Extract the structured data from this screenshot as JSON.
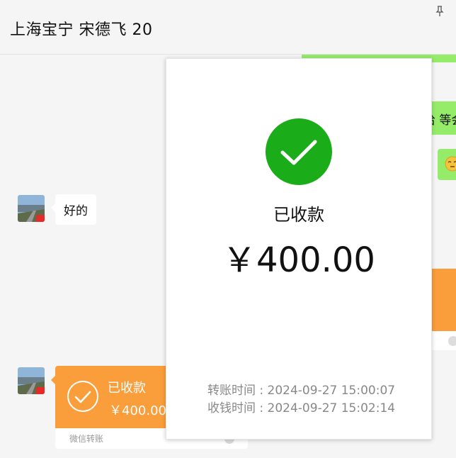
{
  "header": {
    "title": "上海宝宁 宋德飞 20",
    "pin_icon": "pin-icon"
  },
  "messages": [
    {
      "type": "text",
      "side": "left",
      "avatar": "avatar",
      "text": "好的"
    },
    {
      "type": "transfer",
      "side": "left",
      "status": "已收款",
      "amount": "￥400.00",
      "brand": "微信转账",
      "icon": "check-circle-icon"
    }
  ],
  "background_right": {
    "partial_text": "给 等会",
    "emoji_icon": "sleepy-face-emoji-icon"
  },
  "popup": {
    "icon": "check-circle-icon",
    "status": "已收款",
    "amount": "￥400.00",
    "transfer_time": "转账时间 : 2024-09-27 15:00:07",
    "receive_time": "收钱时间 : 2024-09-27 15:02:14"
  },
  "colors": {
    "wechat_green": "#1aad19",
    "bubble_green": "#95ec69",
    "transfer_orange": "#fa9d3b",
    "background": "#f5f5f5"
  }
}
